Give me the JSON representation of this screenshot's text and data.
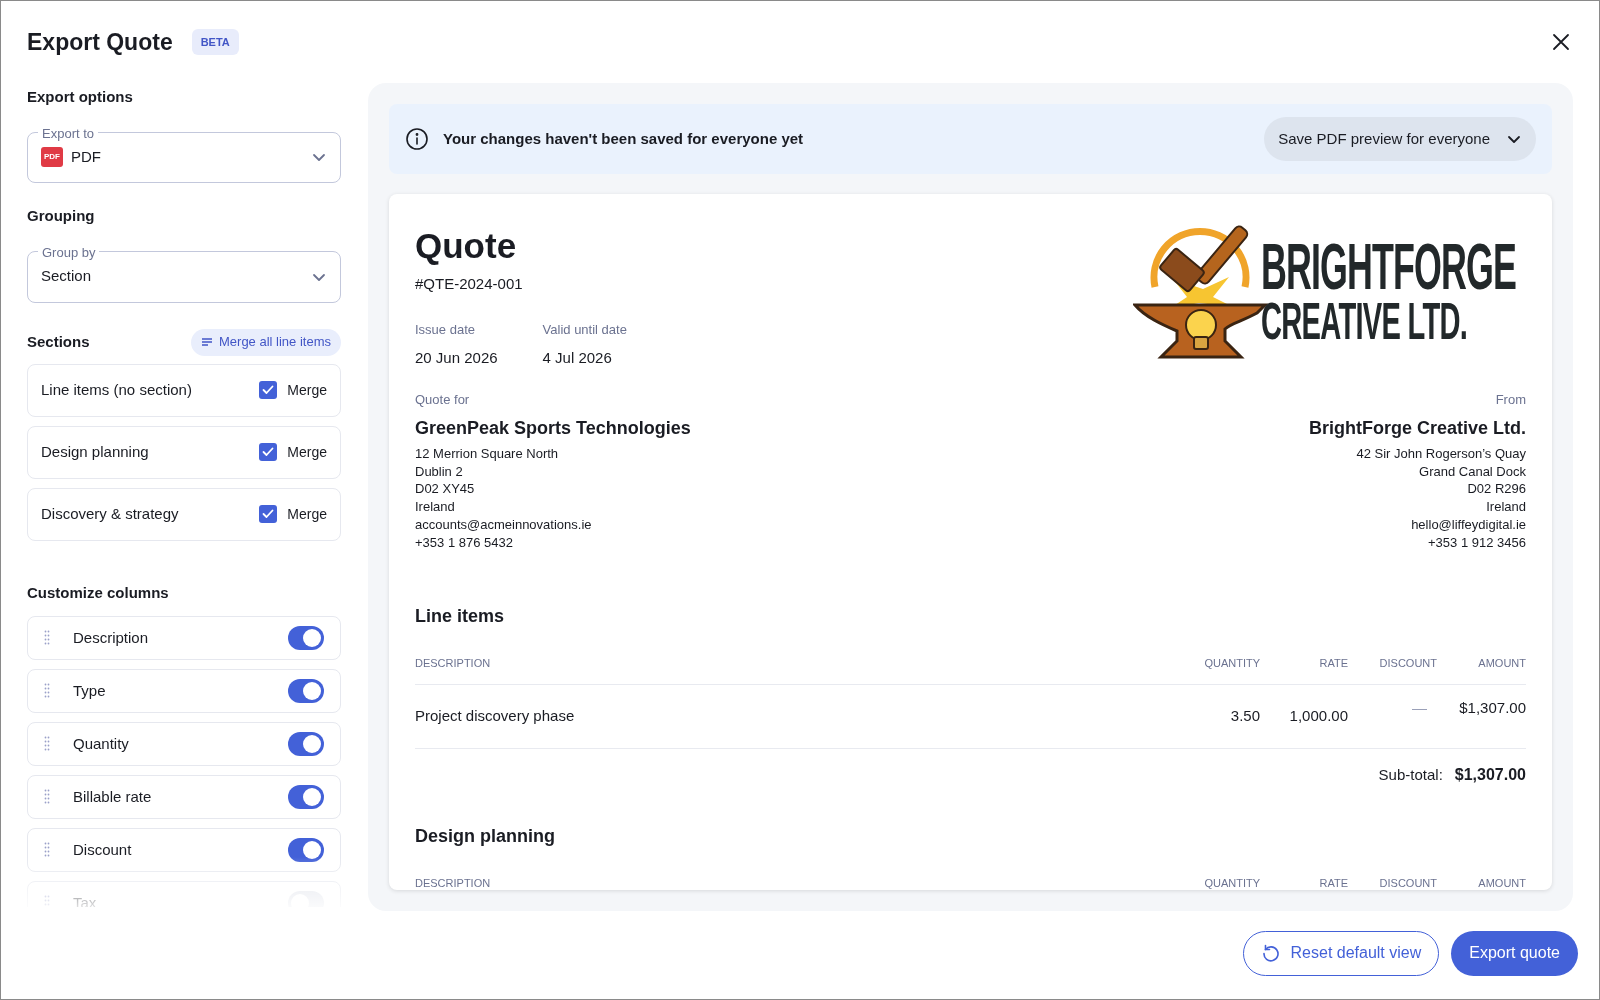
{
  "dialog": {
    "title": "Export Quote",
    "badge": "BETA"
  },
  "export_options": {
    "heading": "Export options",
    "export_to": {
      "label": "Export to",
      "value": "PDF",
      "icon_text": "PDF"
    }
  },
  "grouping": {
    "heading": "Grouping",
    "group_by": {
      "label": "Group by",
      "value": "Section"
    }
  },
  "sections": {
    "heading": "Sections",
    "merge_all_button": "Merge all line items",
    "items": [
      {
        "name": "Line items (no section)",
        "merge_label": "Merge",
        "checked": true
      },
      {
        "name": "Design planning",
        "merge_label": "Merge",
        "checked": true
      },
      {
        "name": "Discovery & strategy",
        "merge_label": "Merge",
        "checked": true
      }
    ]
  },
  "columns": {
    "heading": "Customize columns",
    "items": [
      {
        "label": "Description",
        "on": true
      },
      {
        "label": "Type",
        "on": true
      },
      {
        "label": "Quantity",
        "on": true
      },
      {
        "label": "Billable rate",
        "on": true
      },
      {
        "label": "Discount",
        "on": true
      },
      {
        "label": "Tax",
        "on": false
      }
    ]
  },
  "banner": {
    "message": "Your changes haven't been saved for everyone yet",
    "button": "Save PDF preview for everyone"
  },
  "quote": {
    "title": "Quote",
    "number": "#QTE-2024-001",
    "dates": [
      {
        "label": "Issue date",
        "value": "20 Jun 2026"
      },
      {
        "label": "Valid until date",
        "value": "4 Jul 2026"
      }
    ],
    "logo": {
      "lines": [
        "BRIGHTFORGE",
        "CREATIVE LTD."
      ]
    },
    "quote_for": {
      "label": "Quote for",
      "name": "GreenPeak Sports Technologies",
      "lines": [
        "12 Merrion Square North",
        "Dublin 2",
        "D02 XY45",
        "Ireland",
        "accounts@acmeinnovations.ie",
        "+353 1 876 5432"
      ]
    },
    "from": {
      "label": "From",
      "name": "BrightForge Creative Ltd.",
      "lines": [
        "42 Sir John Rogerson’s Quay",
        "Grand Canal Dock",
        "D02 R296",
        "Ireland",
        "hello@liffeydigital.ie",
        "+353 1 912 3456"
      ]
    },
    "sections": [
      {
        "title": "Line items",
        "columns": [
          "DESCRIPTION",
          "QUANTITY",
          "RATE",
          "DISCOUNT",
          "AMOUNT"
        ],
        "rows": [
          {
            "cells": [
              "Project discovery phase",
              "3.50",
              "1,000.00",
              "—",
              "$1,307.00"
            ]
          }
        ],
        "subtotal": {
          "label": "Sub-total:",
          "value": "$1,307.00"
        }
      },
      {
        "title": "Design planning",
        "columns": [
          "DESCRIPTION",
          "QUANTITY",
          "RATE",
          "DISCOUNT",
          "AMOUNT"
        ]
      }
    ]
  },
  "footer": {
    "reset": "Reset default view",
    "export": "Export quote"
  }
}
